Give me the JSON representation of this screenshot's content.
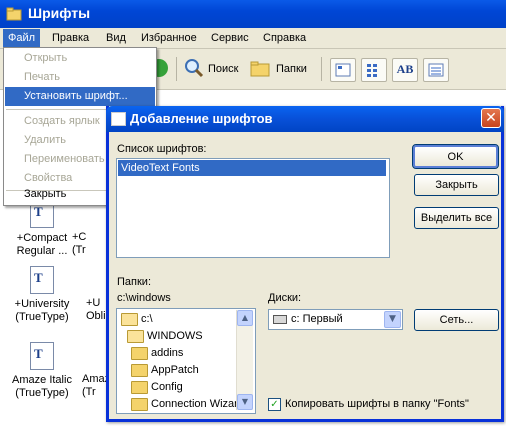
{
  "window": {
    "title": "Шрифты"
  },
  "menubar": {
    "items": [
      "Файл",
      "Правка",
      "Вид",
      "Избранное",
      "Сервис",
      "Справка"
    ]
  },
  "toolbar": {
    "search_label": "Поиск",
    "folders_label": "Папки",
    "view_ab": "AB"
  },
  "file_menu": {
    "items": [
      {
        "label": "Открыть",
        "state": "disabled"
      },
      {
        "label": "Печать",
        "state": "disabled"
      },
      {
        "label": "Установить шрифт...",
        "state": "highlighted"
      },
      {
        "label": "Создать ярлык",
        "state": "disabled"
      },
      {
        "label": "Удалить",
        "state": "disabled"
      },
      {
        "label": "Переименовать",
        "state": "disabled"
      },
      {
        "label": "Свойства",
        "state": "disabled"
      },
      {
        "label": "Закрыть",
        "state": "enabled"
      }
    ]
  },
  "font_files": [
    {
      "line1": "+Compact",
      "line2": "Regular ..."
    },
    {
      "line1": "+C",
      "line2": "(Tr"
    },
    {
      "line1": "+University",
      "line2": "(TrueType)"
    },
    {
      "line1": "+U",
      "line2": "Obli"
    },
    {
      "line1": "Amaze Italic",
      "line2": "(TrueType)"
    },
    {
      "line1": "Amaz",
      "line2": "(Tr"
    }
  ],
  "dialog": {
    "title": "Добавление шрифтов",
    "font_list_label": "Список шрифтов:",
    "font_list_items": [
      "VideoText Fonts"
    ],
    "folders_label": "Папки:",
    "current_path": "c:\\windows",
    "folders": [
      "c:\\",
      "WINDOWS",
      "addins",
      "AppPatch",
      "Config",
      "Connection Wizar"
    ],
    "drives_label": "Диски:",
    "drive_value": "c: Первый",
    "buttons": {
      "ok": "OK",
      "close": "Закрыть",
      "select_all": "Выделить все",
      "network": "Сеть..."
    },
    "copy_checkbox": {
      "label": "Копировать шрифты в папку \"Fonts\"",
      "checked": true
    }
  },
  "colors": {
    "titlebar": "#0046d5",
    "highlight": "#316ac5",
    "dialog_bg": "#ece9d8"
  }
}
